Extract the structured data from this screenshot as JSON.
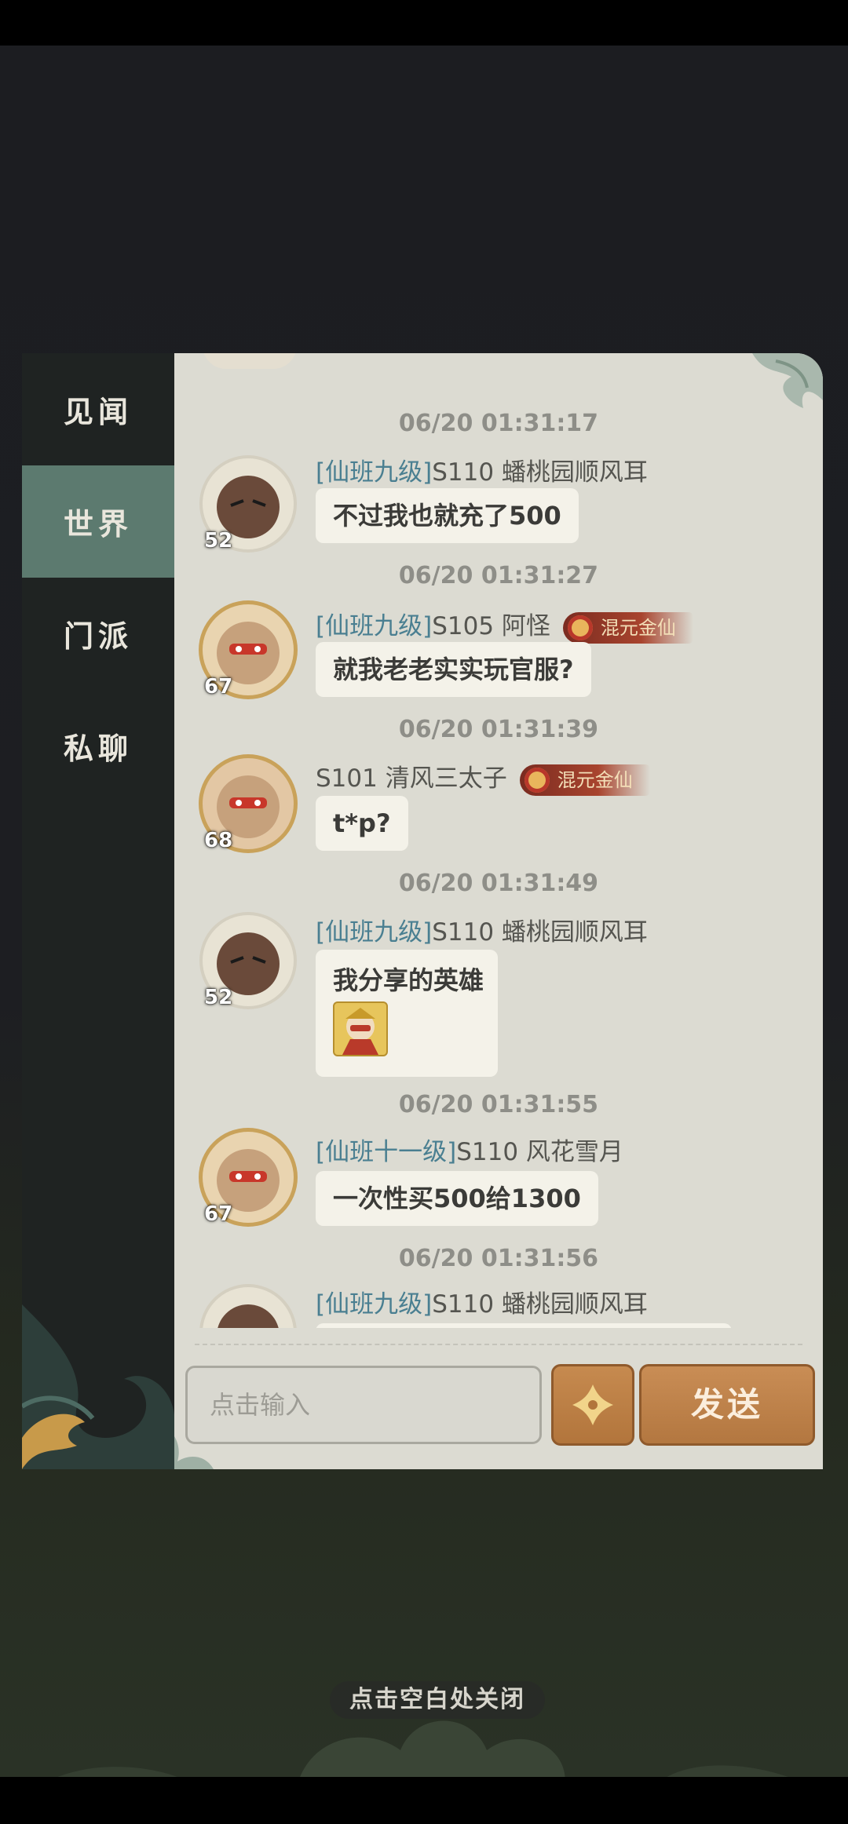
{
  "tabs": [
    {
      "label": "见闻",
      "active": false
    },
    {
      "label": "世界",
      "active": true
    },
    {
      "label": "门派",
      "active": false
    },
    {
      "label": "私聊",
      "active": false
    }
  ],
  "messages": [
    {
      "timestamp": "06/20 01:31:17",
      "rank": "[仙班九级]",
      "sender": "S110 蟠桃园顺风耳",
      "badge": "",
      "level": "52",
      "text": "不过我也就充了500"
    },
    {
      "timestamp": "06/20 01:31:27",
      "rank": "[仙班九级]",
      "sender": "S105 阿怪",
      "badge": "混元金仙",
      "level": "67",
      "text": "就我老老实实玩官服?"
    },
    {
      "timestamp": "06/20 01:31:39",
      "rank": "",
      "sender": "S101 清风三太子",
      "badge": "混元金仙",
      "level": "68",
      "text": "t*p?"
    },
    {
      "timestamp": "06/20 01:31:49",
      "rank": "[仙班九级]",
      "sender": "S110 蟠桃园顺风耳",
      "badge": "",
      "level": "52",
      "text": "我分享的英雄"
    },
    {
      "timestamp": "06/20 01:31:55",
      "rank": "[仙班十一级]",
      "sender": "S110 风花雪月",
      "badge": "",
      "level": "67",
      "text": "一次性买500给1300"
    },
    {
      "timestamp": "06/20 01:31:56",
      "rank": "[仙班九级]",
      "sender": "S110 蟠桃园顺风耳",
      "badge": "",
      "level": "",
      "text": ""
    }
  ],
  "input": {
    "placeholder": "点击输入"
  },
  "send_label": "发送",
  "close_hint": "点击空白处关闭",
  "colors": {
    "accent_tab": "#5c7a6f",
    "rank_text": "#4a7f91",
    "button": "#c08650"
  }
}
